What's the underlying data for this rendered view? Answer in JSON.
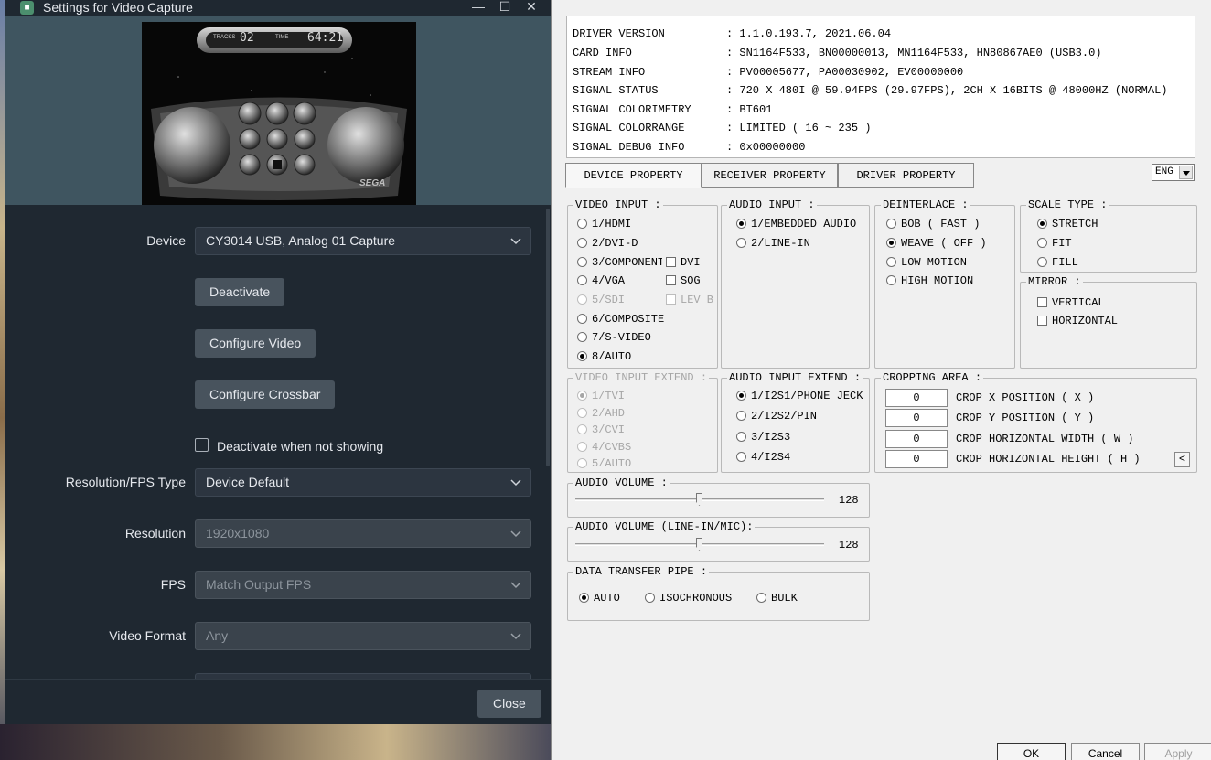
{
  "obs": {
    "title": "Settings for Video Capture",
    "preview": {
      "tracks_label": "TRACKS",
      "tracks_value": "02",
      "time_label": "TIME",
      "time_value": "64:21",
      "brand": "SEGA"
    },
    "device_label": "Device",
    "device_value": "CY3014 USB, Analog 01 Capture",
    "deactivate_label": "Deactivate",
    "configure_video_label": "Configure Video",
    "configure_crossbar_label": "Configure Crossbar",
    "deactivate_when_not_showing_label": "Deactivate when not showing",
    "deactivate_when_not_showing_checked": false,
    "resfps_label": "Resolution/FPS Type",
    "resfps_value": "Device Default",
    "resolution_label": "Resolution",
    "resolution_value": "1920x1080",
    "fps_label": "FPS",
    "fps_value": "Match Output FPS",
    "video_format_label": "Video Format",
    "video_format_value": "Any",
    "close_label": "Close"
  },
  "driver": {
    "info": [
      {
        "key": "DRIVER VERSION",
        "value": ": 1.1.0.193.7, 2021.06.04"
      },
      {
        "key": "CARD INFO",
        "value": ": SN1164F533, BN00000013, MN1164F533, HN80867AE0 (USB3.0)"
      },
      {
        "key": "STREAM INFO",
        "value": ": PV00005677, PA00030902, EV00000000"
      },
      {
        "key": "SIGNAL STATUS",
        "value": ": 720 X 480I @ 59.94FPS (29.97FPS), 2CH X 16BITS @ 48000HZ (NORMAL)"
      },
      {
        "key": "SIGNAL COLORIMETRY",
        "value": ": BT601"
      },
      {
        "key": "SIGNAL COLORRANGE",
        "value": ": LIMITED ( 16 ~ 235 )"
      },
      {
        "key": "SIGNAL DEBUG INFO",
        "value": ": 0x00000000"
      }
    ],
    "tabs": [
      "DEVICE PROPERTY",
      "RECEIVER PROPERTY",
      "DRIVER PROPERTY"
    ],
    "active_tab": "DEVICE PROPERTY",
    "language": "ENG",
    "video_input": {
      "title": "VIDEO INPUT :",
      "options": [
        "1/HDMI",
        "2/DVI-D",
        "3/COMPONENT",
        "4/VGA",
        "5/SDI",
        "6/COMPOSITE",
        "7/S-VIDEO",
        "8/AUTO"
      ],
      "selected": "8/AUTO",
      "checks": [
        "DVI",
        "SOG",
        "LEV B"
      ]
    },
    "audio_input": {
      "title": "AUDIO INPUT :",
      "options": [
        "1/EMBEDDED AUDIO",
        "2/LINE-IN"
      ],
      "selected": "1/EMBEDDED AUDIO"
    },
    "deinterlace": {
      "title": "DEINTERLACE :",
      "options": [
        "BOB ( FAST )",
        "WEAVE ( OFF )",
        "LOW MOTION",
        "HIGH MOTION"
      ],
      "selected": "WEAVE ( OFF )"
    },
    "scale_type": {
      "title": "SCALE TYPE :",
      "options": [
        "STRETCH",
        "FIT",
        "FILL"
      ],
      "selected": "STRETCH"
    },
    "mirror": {
      "title": "MIRROR :",
      "options": [
        "VERTICAL",
        "HORIZONTAL"
      ]
    },
    "video_input_extend": {
      "title": "VIDEO INPUT EXTEND :",
      "options": [
        "1/TVI",
        "2/AHD",
        "3/CVI",
        "4/CVBS",
        "5/AUTO"
      ],
      "selected": "1/TVI"
    },
    "audio_input_extend": {
      "title": "AUDIO INPUT EXTEND :",
      "options": [
        "1/I2S1/PHONE JECK",
        "2/I2S2/PIN",
        "3/I2S3",
        "4/I2S4"
      ],
      "selected": "1/I2S1/PHONE JECK"
    },
    "cropping": {
      "title": "CROPPING AREA :",
      "rows": [
        {
          "label": "CROP X POSITION ( X )",
          "value": "0"
        },
        {
          "label": "CROP Y POSITION ( Y )",
          "value": "0"
        },
        {
          "label": "CROP HORIZONTAL WIDTH ( W )",
          "value": "0"
        },
        {
          "label": "CROP HORIZONTAL HEIGHT ( H )",
          "value": "0"
        }
      ],
      "collapse_symbol": "<"
    },
    "audio_volume": {
      "title": "AUDIO VOLUME :",
      "value": "128",
      "fraction": 0.5
    },
    "audio_volume_linein": {
      "title": "AUDIO VOLUME (LINE-IN/MIC):",
      "value": "128",
      "fraction": 0.5
    },
    "data_transfer": {
      "title": "DATA TRANSFER PIPE :",
      "options": [
        "AUTO",
        "ISOCHRONOUS",
        "BULK"
      ],
      "selected": "AUTO"
    },
    "buttons": {
      "ok": "OK",
      "cancel": "Cancel",
      "apply": "Apply"
    }
  }
}
